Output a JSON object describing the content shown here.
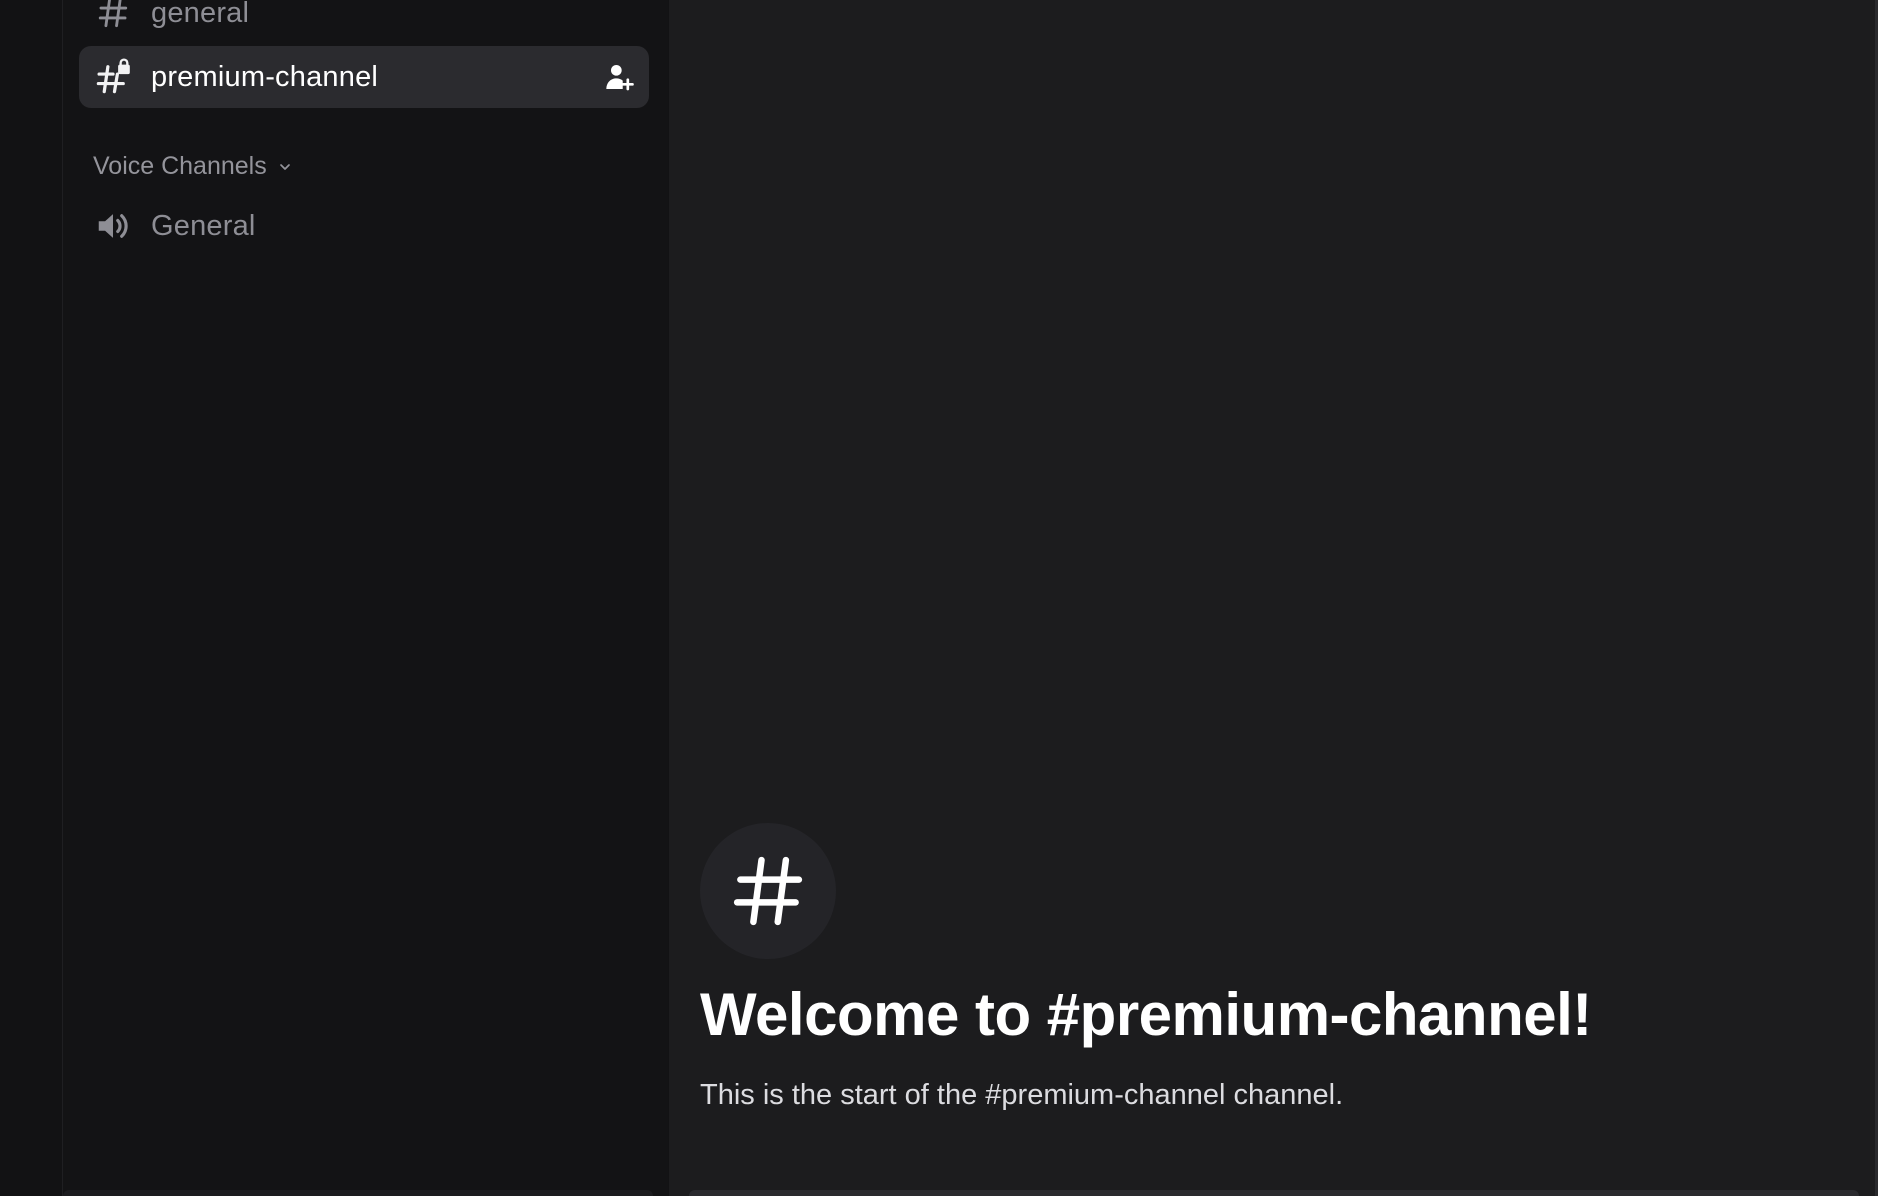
{
  "sidebar": {
    "text_channels": [
      {
        "name": "general",
        "icon": "hash-icon",
        "selected": false
      },
      {
        "name": "premium-channel",
        "icon": "locked-hash-icon",
        "selected": true,
        "action_icon": "add-member-icon"
      }
    ],
    "voice_category": {
      "label": "Voice Channels",
      "icon": "chevron-down-icon"
    },
    "voice_channels": [
      {
        "name": "General",
        "icon": "speaker-icon"
      }
    ]
  },
  "main": {
    "welcome_icon": "hash-icon",
    "welcome_title": "Welcome to #premium-channel!",
    "welcome_subtitle": "This is the start of the #premium-channel channel."
  },
  "colors": {
    "sidebar_bg": "#131315",
    "main_bg": "#1c1c1e",
    "selected_row_bg": "#2b2b2f",
    "muted_text": "#8e8e95",
    "bright_text": "#ffffff"
  }
}
